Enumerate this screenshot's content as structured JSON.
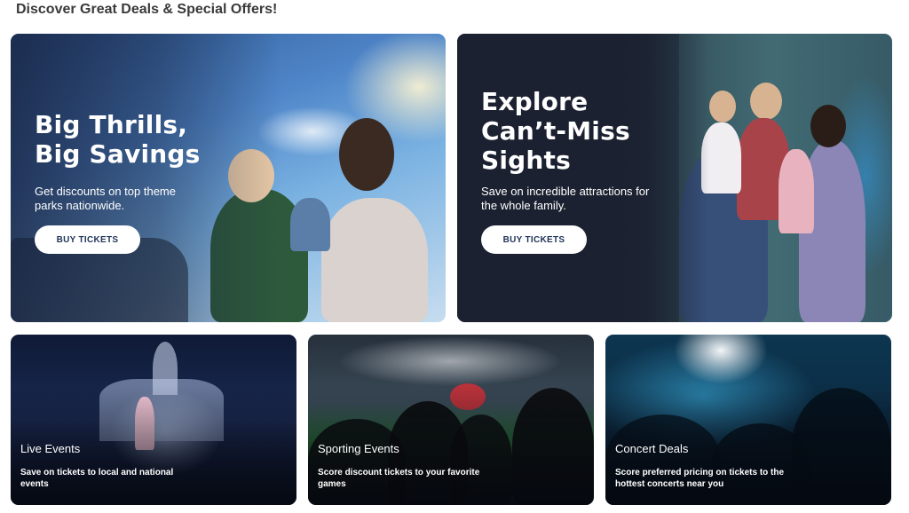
{
  "page": {
    "heading": "Discover Great Deals & Special Offers!"
  },
  "featured": [
    {
      "title": "Big Thrills, Big Savings",
      "description": "Get discounts on top theme parks nationwide.",
      "button_label": "BUY TICKETS"
    },
    {
      "title": "Explore Can’t-Miss Sights",
      "description": "Save on incredible attractions for the whole family.",
      "button_label": "BUY TICKETS"
    }
  ],
  "categories": [
    {
      "title": "Live Events",
      "description": "Save on tickets to local and national events"
    },
    {
      "title": "Sporting Events",
      "description": "Score discount tickets to your favorite games"
    },
    {
      "title": "Concert Deals",
      "description": "Score preferred pricing on tickets to the hottest concerts near you"
    }
  ],
  "colors": {
    "heading_text": "#3a3a3a",
    "button_background": "#ffffff",
    "button_text": "#1f3358",
    "card_dark": "#1b2130"
  }
}
